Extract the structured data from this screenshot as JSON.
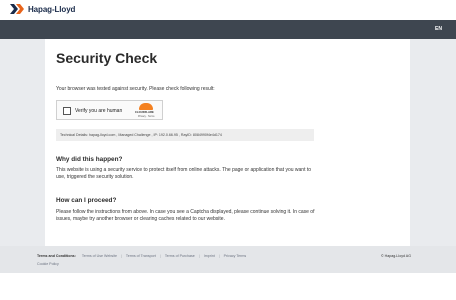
{
  "brand": {
    "logo_text": "Hapag-Lloyd",
    "color": "#1a2b4a"
  },
  "navbar": {
    "language": "EN",
    "bg_color": "#3e4650"
  },
  "main": {
    "title": "Security Check",
    "intro": "Your browser was tested against security. Please check following result:",
    "captcha": {
      "label": "Verify you are human",
      "provider": "CLOUDFLARE",
      "privacy": "Privacy",
      "terms": "Terms",
      "accent_color": "#f48120"
    },
    "technical_details": "Technical Details: hapag-lloyd.com , Managed Challenge , IP: 192.0.66.95 , RayID: 8084990f4e4d174",
    "why": {
      "heading": "Why did this happen?",
      "text": "This website is using a security service to protect itself from online attacks. The page or application that you want to use, triggered the security solution."
    },
    "how": {
      "heading": "How can I proceed?",
      "text": "Please follow the instructions from above. In case you see a Captcha displayed, please continue solving it. In case of issues, maybe try another browser or clearing caches related to our website."
    }
  },
  "footer": {
    "label": "Terms and Conditions:",
    "links": [
      "Terms of Use Website",
      "Terms of Transport",
      "Terms of Purchase",
      "Imprint",
      "Privacy Terms"
    ],
    "cookie": "Cookie Policy",
    "copyright": "© Hapag-Lloyd AG"
  }
}
